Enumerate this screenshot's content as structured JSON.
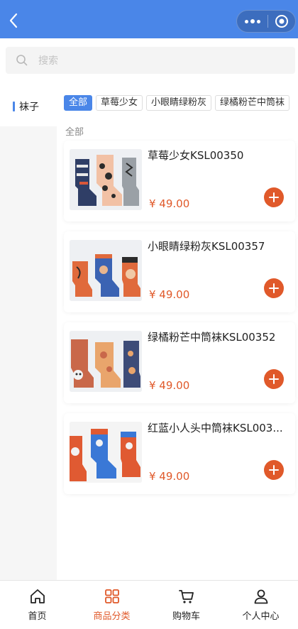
{
  "header": {
    "back_icon": "chevron-left-icon",
    "menu_icon": "more-dots-icon",
    "close_icon": "target-circle-icon",
    "color": "#4a86e8"
  },
  "search": {
    "placeholder": "搜索",
    "icon": "search-icon"
  },
  "categories": [
    {
      "label": "袜子",
      "active": true
    }
  ],
  "tags": [
    {
      "label": "全部",
      "active": true
    },
    {
      "label": "草莓少女",
      "active": false
    },
    {
      "label": "小眼睛绿粉灰",
      "active": false
    },
    {
      "label": "绿橘粉芒中筒袜",
      "active": false
    }
  ],
  "section_title": "全部",
  "products": [
    {
      "name": "草莓少女KSL00350",
      "price": "¥ 49.00"
    },
    {
      "name": "小眼睛绿粉灰KSL00357",
      "price": "¥ 49.00"
    },
    {
      "name": "绿橘粉芒中筒袜KSL00352",
      "price": "¥ 49.00"
    },
    {
      "name": "红蓝小人头中筒袜KSL003...",
      "price": "¥ 49.00"
    }
  ],
  "tabbar": [
    {
      "label": "首页",
      "icon": "home-icon",
      "active": false
    },
    {
      "label": "商品分类",
      "icon": "category-grid-icon",
      "active": true
    },
    {
      "label": "购物车",
      "icon": "cart-icon",
      "active": false
    },
    {
      "label": "个人中心",
      "icon": "user-icon",
      "active": false
    }
  ],
  "colors": {
    "accent": "#e0592a",
    "primary": "#4a86e8"
  }
}
